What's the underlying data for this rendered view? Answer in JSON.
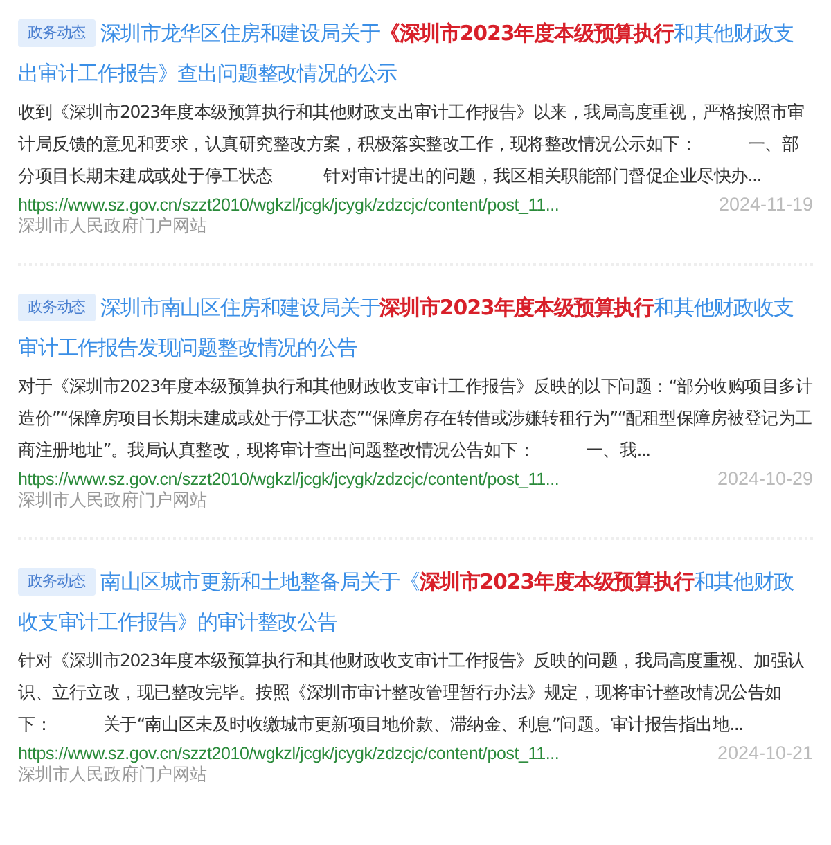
{
  "results": [
    {
      "tag": "政务动态",
      "title": "深圳市龙华区住房和建设局关于**《深圳市2023年度本级预算执行**和其他财政支出审计工作报告》查出问题整改情况的公示",
      "snippet": "收到《深圳市2023年度本级预算执行和其他财政支出审计工作报告》以来，我局高度重视，严格按照市审计局反馈的意见和要求，认真研究整改方案，积极落实整改工作，现将整改情况公示如下：　　　一、部分项目长期未建成或处于停工状态　　　针对审计提出的问题，我区相关职能部门督促企业尽快办...",
      "url": "https://www.sz.gov.cn/szzt2010/wgkzl/jcgk/jcygk/zdzcjc/content/post_11...",
      "date": "2024-11-19",
      "source": "深圳市人民政府门户网站"
    },
    {
      "tag": "政务动态",
      "title": "深圳市南山区住房和建设局关于**深圳市2023年度本级预算执行**和其他财政收支审计工作报告发现问题整改情况的公告",
      "snippet": "对于《深圳市2023年度本级预算执行和其他财政收支审计工作报告》反映的以下问题：“部分收购项目多计造价”“保障房项目长期未建成或处于停工状态”“保障房存在转借或涉嫌转租行为”“配租型保障房被登记为工商注册地址”。我局认真整改，现将审计查出问题整改情况公告如下：　　　一、我...",
      "url": "https://www.sz.gov.cn/szzt2010/wgkzl/jcgk/jcygk/zdzcjc/content/post_11...",
      "date": "2024-10-29",
      "source": "深圳市人民政府门户网站"
    },
    {
      "tag": "政务动态",
      "title": "南山区城市更新和土地整备局关于《**深圳市2023年度本级预算执行**和其他财政收支审计工作报告》的审计整改公告",
      "snippet": "针对《深圳市2023年度本级预算执行和其他财政收支审计工作报告》反映的问题，我局高度重视、加强认识、立行立改，现已整改完毕。按照《深圳市审计整改管理暂行办法》规定，现将审计整改情况公告如下：　　　关于“南山区未及时收缴城市更新项目地价款、滞纳金、利息”问题。审计报告指出地...",
      "url": "https://www.sz.gov.cn/szzt2010/wgkzl/jcgk/jcygk/zdzcjc/content/post_11...",
      "date": "2024-10-21",
      "source": "深圳市人民政府门户网站"
    }
  ]
}
